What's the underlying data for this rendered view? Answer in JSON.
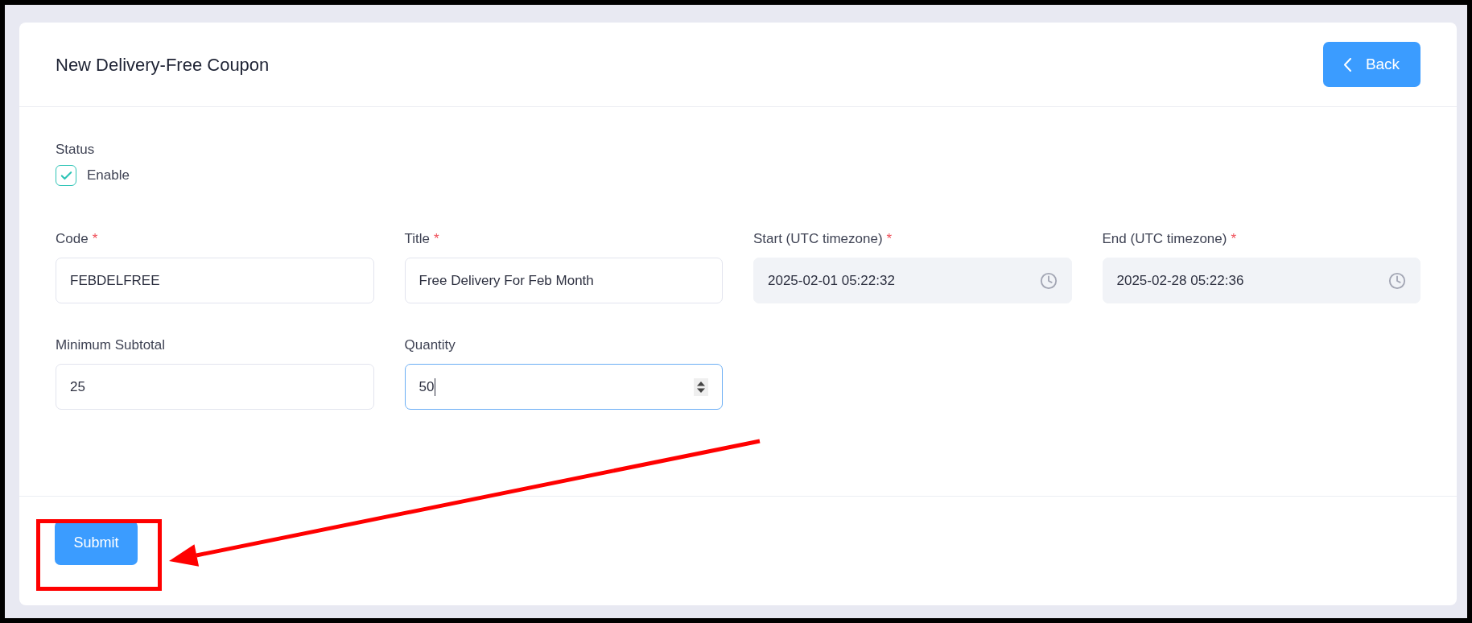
{
  "header": {
    "title": "New Delivery-Free Coupon",
    "back_button": "Back"
  },
  "status": {
    "label": "Status",
    "option": "Enable",
    "checked": true
  },
  "fields": [
    {
      "label": "Code",
      "required_mark": "*",
      "value": "FEBDELFREE",
      "kind": "text",
      "focused": false
    },
    {
      "label": "Title",
      "required_mark": "*",
      "value": "Free Delivery For Feb Month",
      "kind": "text",
      "focused": false
    },
    {
      "label": "Start (UTC timezone)",
      "required_mark": "*",
      "value": "2025-02-01 05:22:32",
      "kind": "datetime",
      "focused": false
    },
    {
      "label": "End (UTC timezone)",
      "required_mark": "*",
      "value": "2025-02-28 05:22:36",
      "kind": "datetime",
      "focused": false
    },
    {
      "label": "Minimum Subtotal",
      "value": "25",
      "kind": "text",
      "focused": false
    },
    {
      "label": "Quantity",
      "value": "50",
      "kind": "number",
      "focused": true
    }
  ],
  "submit_button": "Submit"
}
